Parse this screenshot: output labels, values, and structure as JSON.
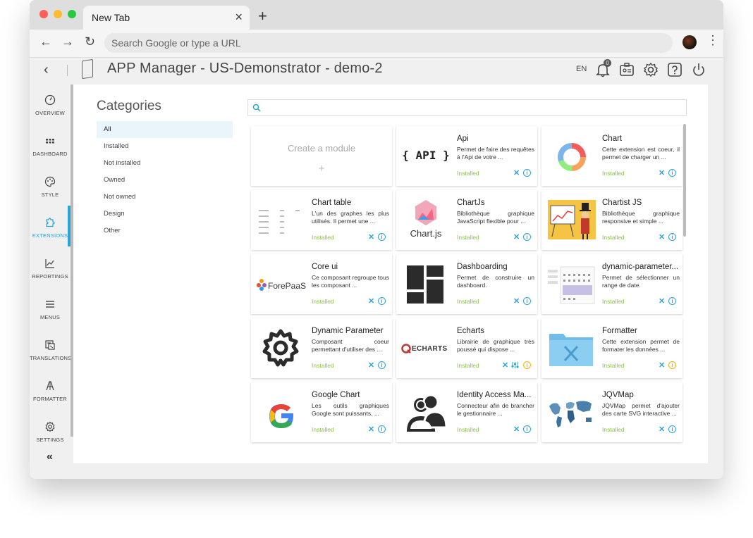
{
  "browser": {
    "tab_title": "New Tab",
    "address_placeholder": "Search Google or type a URL"
  },
  "header": {
    "title": "APP Manager - US-Demonstrator - demo-2",
    "language": "EN",
    "notification_count": "0"
  },
  "sidebar": {
    "items": [
      {
        "label": "OVERVIEW",
        "icon": "gauge-icon"
      },
      {
        "label": "DASHBOARD",
        "icon": "grid-icon"
      },
      {
        "label": "STYLE",
        "icon": "palette-icon"
      },
      {
        "label": "EXTENSIONS",
        "icon": "puzzle-icon"
      },
      {
        "label": "REPORTINGS",
        "icon": "chart-line-icon"
      },
      {
        "label": "MENUS",
        "icon": "menu-icon"
      },
      {
        "label": "TRANSLATIONS",
        "icon": "translate-icon"
      },
      {
        "label": "FORMATTER",
        "icon": "formatter-icon"
      },
      {
        "label": "SETTINGS",
        "icon": "gear-icon"
      }
    ],
    "collapse_label": "«"
  },
  "categories": {
    "title": "Categories",
    "items": [
      "All",
      "Installed",
      "Not installed",
      "Owned",
      "Not owned",
      "Design",
      "Other"
    ]
  },
  "create_module": {
    "label": "Create a module",
    "plus": "+"
  },
  "modules": [
    {
      "title": "Api",
      "desc": "Permet de faire des requêtes à l'Api de votre ...",
      "status": "Installed",
      "thumb_text": "{ API }"
    },
    {
      "title": "Chart",
      "desc": "Cette extension est coeur, il permet de charger un ...",
      "status": "Installed"
    },
    {
      "title": "Chart table",
      "desc": "L'un des graphes les plus utilisés. Il permet une ...",
      "status": "Installed"
    },
    {
      "title": "ChartJs",
      "desc": "Bibliothèque graphique JavaScript flexible pour ...",
      "status": "Installed",
      "thumb_text": "Chart.js"
    },
    {
      "title": "Chartist JS",
      "desc": "Bibliothèque graphique responsive et simple ...",
      "status": "Installed"
    },
    {
      "title": "Core ui",
      "desc": "Ce composant regroupe tous les composant ...",
      "status": "Installed",
      "thumb_text": "ForePaaS"
    },
    {
      "title": "Dashboarding",
      "desc": "Permet de construire un dashboard.",
      "status": "Installed"
    },
    {
      "title": "dynamic-parameter...",
      "desc": "Permet de sélectionner un range de date.",
      "status": "Installed"
    },
    {
      "title": "Dynamic Parameter",
      "desc": "Composant coeur permettant d'utiliser des ...",
      "status": "Installed"
    },
    {
      "title": "Echarts",
      "desc": "Librairie de graphique très poussé qui dispose ...",
      "status": "Installed",
      "thumb_text": "ECHARTS"
    },
    {
      "title": "Formatter",
      "desc": "Cette extension permet de formater les données ...",
      "status": "Installed"
    },
    {
      "title": "Google Chart",
      "desc": "Les outils graphiques Google sont puissants, ...",
      "status": "Installed"
    },
    {
      "title": "Identity Access Ma...",
      "desc": "Connecteur afin de brancher le gestionnaire ...",
      "status": "Installed"
    },
    {
      "title": "JQVMap",
      "desc": "JQVMap permet d'ajouter des carte SVG interactive ...",
      "status": "Installed"
    }
  ],
  "colors": {
    "accent": "#2aa6d8",
    "installed": "#8bc34a",
    "warning": "#f5b400"
  }
}
